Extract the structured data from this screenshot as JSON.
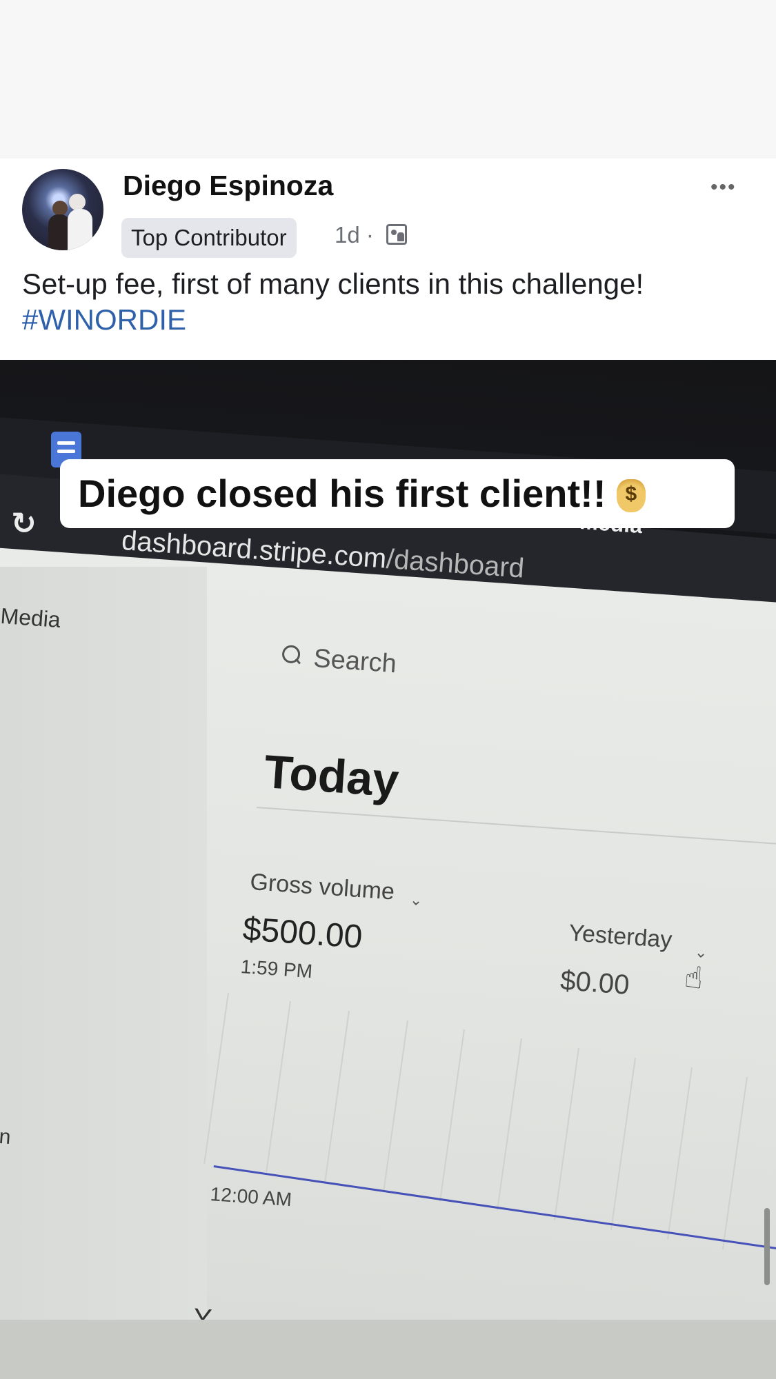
{
  "post": {
    "author": "Diego Espinoza",
    "badge": "Top Contributor",
    "time": "1d ·",
    "more": "•••",
    "text": "Set-up fee, first of many clients in this challenge!",
    "hashtag": "#WINORDIE"
  },
  "photo_overlay": {
    "banner": "Diego closed his first client!!"
  },
  "photo_content": {
    "url_domain": "dashboard.stripe.com",
    "url_path": "/dashboard",
    "media_left": "Media",
    "media_top": "Media",
    "search_label": "Search",
    "today_heading": "Today",
    "gross_volume_label": "Gross volume",
    "gross_volume_value": "$500.00",
    "gross_volume_time": "1:59 PM",
    "yesterday_label": "Yesterday",
    "yesterday_value": "$0.00",
    "chart_axis_label": "12:00 AM",
    "side_fragment": "n",
    "bottom_fragment": "Y"
  },
  "colors": {
    "hashtag": "#2f61ab",
    "chart_line": "#4652b8",
    "badge_bg": "#e4e6eb"
  },
  "icons": {
    "more": "more-options-icon",
    "audience": "photos-icon",
    "bag": "money-bag-icon",
    "search": "search-icon",
    "reload": "reload-icon",
    "cursor": "hand-cursor-icon"
  }
}
